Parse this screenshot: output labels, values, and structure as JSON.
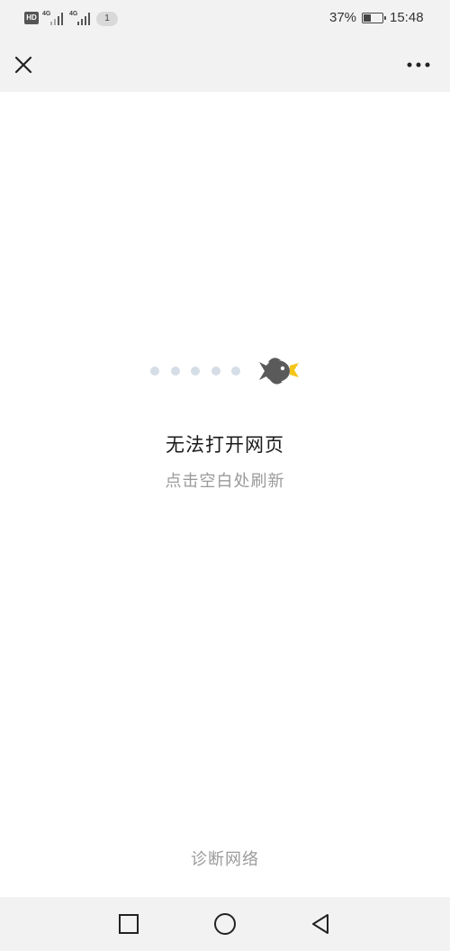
{
  "status_bar": {
    "hd_badge": "HD",
    "network_1": "4G",
    "network_2": "4G",
    "notification_count": "1",
    "battery_percent": "37%",
    "battery_level": 0.37,
    "time": "15:48"
  },
  "header": {
    "close_icon": "close-icon",
    "more_icon": "more-dots-icon"
  },
  "content": {
    "illustration_icon": "bird-icon",
    "error_title": "无法打开网页",
    "error_subtitle": "点击空白处刷新",
    "diagnose_link": "诊断网络"
  },
  "nav_bar": {
    "recent_icon": "square-recents-icon",
    "home_icon": "circle-home-icon",
    "back_icon": "triangle-back-icon"
  },
  "colors": {
    "bar_background": "#f2f2f2",
    "title_text": "#1a1a1a",
    "muted_text": "#9a9a9a",
    "loading_dot": "#d5dde6",
    "bird_body": "#5a5a5a",
    "bird_beak": "#f5c518"
  }
}
